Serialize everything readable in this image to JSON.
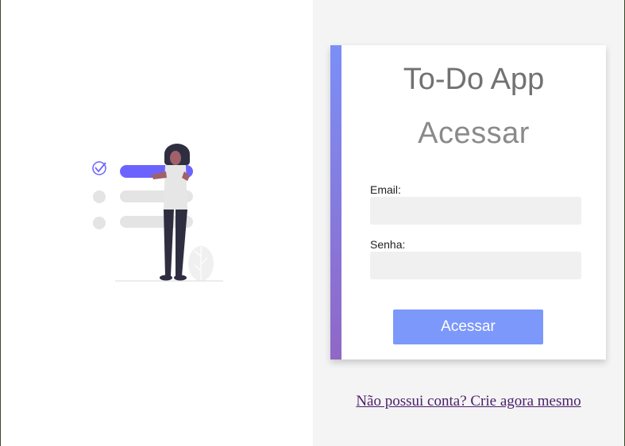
{
  "app": {
    "title": "To-Do App"
  },
  "login_form": {
    "heading": "Acessar",
    "email_label": "Email:",
    "email_value": "",
    "password_label": "Senha:",
    "password_value": "",
    "submit_label": "Acessar"
  },
  "signup_link": {
    "label": "Não possui conta? Crie agora mesmo"
  },
  "colors": {
    "accent_gradient_top": "#7b8ff7",
    "accent_gradient_bottom": "#9067c6",
    "button": "#7c98fb",
    "link": "#4a1f6b",
    "illustration_purple": "#6c63ff"
  },
  "illustration": {
    "icon": "todo-checklist-person-illustration"
  }
}
